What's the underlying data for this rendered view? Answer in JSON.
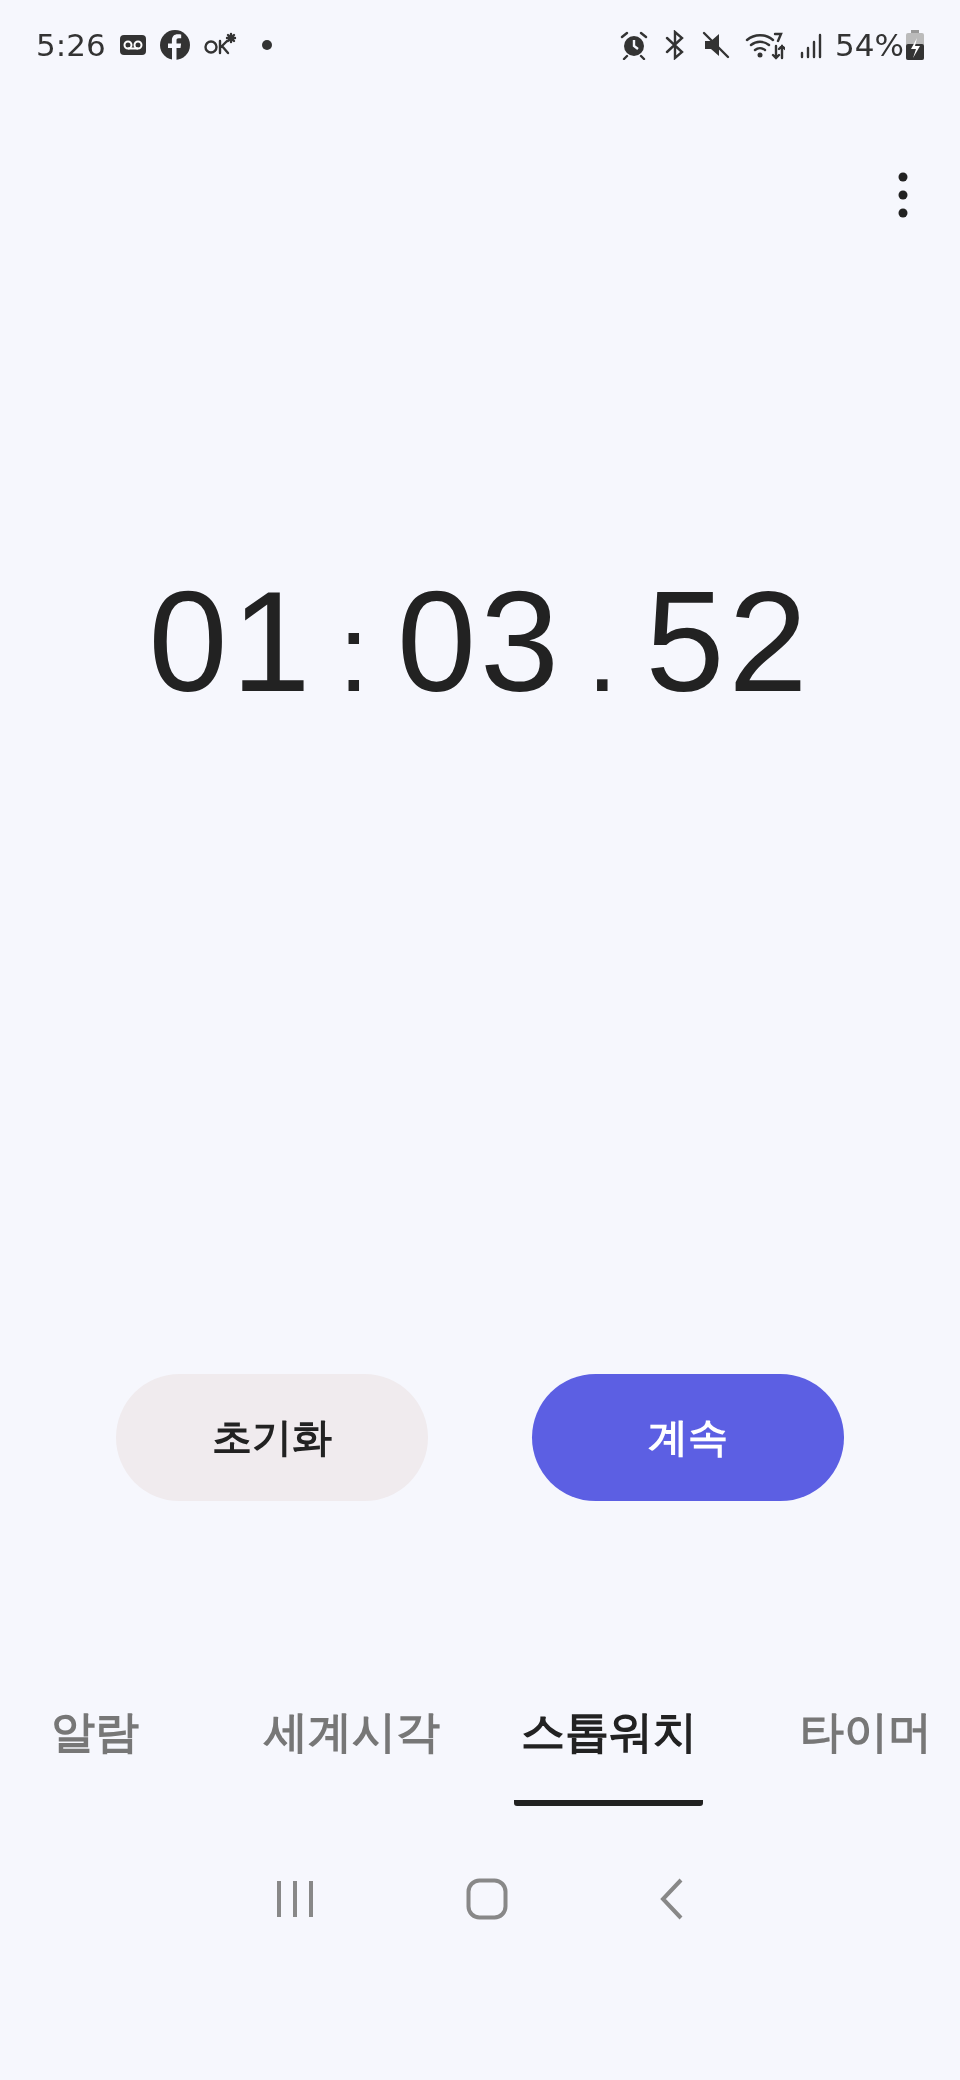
{
  "status_bar": {
    "time": "5:26",
    "battery": "54%"
  },
  "stopwatch": {
    "minutes": "01",
    "separator_1": ":",
    "seconds": "03",
    "separator_2": ".",
    "hundredths": "52"
  },
  "buttons": [
    {
      "label": "초기화",
      "kind": "secondary"
    },
    {
      "label": "계속",
      "kind": "primary"
    }
  ],
  "tabs": [
    {
      "label": "알람",
      "selected": false
    },
    {
      "label": "세계시각",
      "selected": false
    },
    {
      "label": "스톱워치",
      "selected": true
    },
    {
      "label": "타이머",
      "selected": false
    }
  ]
}
